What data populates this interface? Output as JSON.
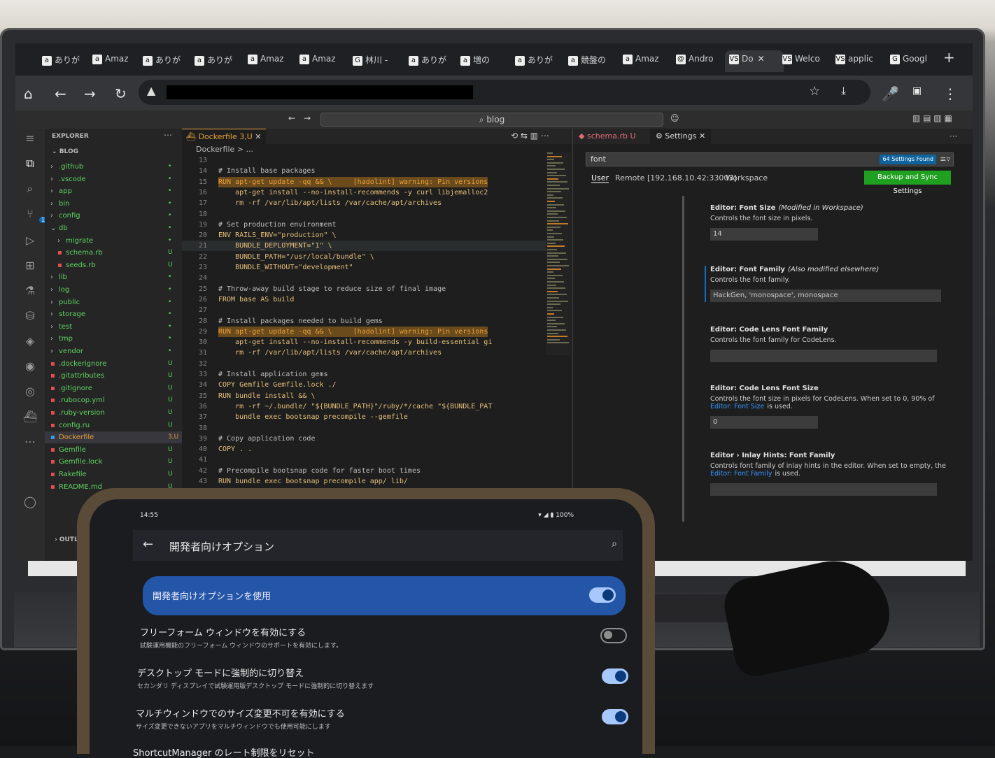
{
  "browser": {
    "tabs": [
      {
        "icon": "a",
        "label": "ありが"
      },
      {
        "icon": "a",
        "label": "Amaz"
      },
      {
        "icon": "a",
        "label": "ありが"
      },
      {
        "icon": "a",
        "label": "ありが"
      },
      {
        "icon": "a",
        "label": "Amaz"
      },
      {
        "icon": "a",
        "label": "Amaz"
      },
      {
        "icon": "G",
        "label": "林川 -"
      },
      {
        "icon": "a",
        "label": "ありが"
      },
      {
        "icon": "a",
        "label": "増の"
      },
      {
        "icon": "a",
        "label": "ありが"
      },
      {
        "icon": "a",
        "label": "競盤の"
      },
      {
        "icon": "a",
        "label": "Amaz"
      },
      {
        "icon": "@",
        "label": "Andro"
      },
      {
        "icon": "VS",
        "label": "Do",
        "active": true
      },
      {
        "icon": "VS",
        "label": "Welco"
      },
      {
        "icon": "VS",
        "label": "applic"
      },
      {
        "icon": "G",
        "label": "Googl"
      }
    ],
    "new_tab": "+",
    "tab_close": "✕"
  },
  "vscode": {
    "command_center": "blog",
    "explorer": {
      "header": "EXPLORER",
      "root": "BLOG",
      "items": [
        {
          "name": ".github",
          "type": "folder",
          "status": "•",
          "color": "#5fd35f"
        },
        {
          "name": ".vscode",
          "type": "folder",
          "status": "•",
          "color": "#5fd35f"
        },
        {
          "name": "app",
          "type": "folder",
          "status": "•",
          "color": "#5fd35f"
        },
        {
          "name": "bin",
          "type": "folder",
          "status": "•",
          "color": "#5fd35f"
        },
        {
          "name": "config",
          "type": "folder",
          "status": "•",
          "color": "#5fd35f"
        },
        {
          "name": "db",
          "type": "folder-open",
          "status": "•",
          "color": "#5fd35f"
        },
        {
          "name": "migrate",
          "type": "folder",
          "status": "•",
          "color": "#5fd35f"
        },
        {
          "name": "schema.rb",
          "type": "file",
          "status": "U",
          "color": "#5fd35f"
        },
        {
          "name": "seeds.rb",
          "type": "file",
          "status": "U",
          "color": "#5fd35f"
        },
        {
          "name": "lib",
          "type": "folder",
          "status": "•",
          "color": "#5fd35f"
        },
        {
          "name": "log",
          "type": "folder",
          "status": "•",
          "color": "#5fd35f"
        },
        {
          "name": "public",
          "type": "folder",
          "status": "•",
          "color": "#5fd35f"
        },
        {
          "name": "storage",
          "type": "folder",
          "status": "•",
          "color": "#5fd35f"
        },
        {
          "name": "test",
          "type": "folder",
          "status": "•",
          "color": "#5fd35f"
        },
        {
          "name": "tmp",
          "type": "folder",
          "status": "•",
          "color": "#5fd35f"
        },
        {
          "name": "vendor",
          "type": "folder",
          "status": "•",
          "color": "#5fd35f"
        },
        {
          "name": ".dockerignore",
          "type": "file",
          "status": "U",
          "color": "#5fd35f"
        },
        {
          "name": ".gitattributes",
          "type": "file",
          "status": "U",
          "color": "#5fd35f"
        },
        {
          "name": ".gitignore",
          "type": "file",
          "status": "U",
          "color": "#5fd35f"
        },
        {
          "name": ".rubocop.yml",
          "type": "file",
          "status": "U",
          "color": "#5fd35f"
        },
        {
          "name": ".ruby-version",
          "type": "file",
          "status": "U",
          "color": "#5fd35f"
        },
        {
          "name": "config.ru",
          "type": "file",
          "status": "U",
          "color": "#5fd35f"
        },
        {
          "name": "Dockerfile",
          "type": "file",
          "status": "3,U",
          "color": "#e8a23c",
          "selected": true
        },
        {
          "name": "Gemfile",
          "type": "file",
          "status": "U",
          "color": "#5fd35f"
        },
        {
          "name": "Gemfile.lock",
          "type": "file",
          "status": "U",
          "color": "#5fd35f"
        },
        {
          "name": "Rakefile",
          "type": "file",
          "status": "U",
          "color": "#5fd35f"
        },
        {
          "name": "README.md",
          "type": "file",
          "status": "U",
          "color": "#5fd35f"
        }
      ],
      "outline": "OUTLINE",
      "activity_badge": "115"
    },
    "editor": {
      "tab_label": "Dockerfile",
      "tab_status": "3,U",
      "breadcrumb": "Dockerfile > ...",
      "lines": [
        {
          "n": "13",
          "t": ""
        },
        {
          "n": "14",
          "t": "# Install base packages",
          "k": "comment"
        },
        {
          "n": "15",
          "t": "RUN apt-get update -qq && \\     [hadolint] warning: Pin versions",
          "k": "warn"
        },
        {
          "n": "16",
          "t": "    apt-get install --no-install-recommends -y curl libjemalloc2",
          "k": "code"
        },
        {
          "n": "17",
          "t": "    rm -rf /var/lib/apt/lists /var/cache/apt/archives",
          "k": "code"
        },
        {
          "n": "18",
          "t": ""
        },
        {
          "n": "19",
          "t": "# Set production environment",
          "k": "comment"
        },
        {
          "n": "20",
          "t": "ENV RAILS_ENV=\"production\" \\",
          "k": "code"
        },
        {
          "n": "21",
          "t": "    BUNDLE_DEPLOYMENT=\"1\" \\",
          "k": "cur"
        },
        {
          "n": "22",
          "t": "    BUNDLE_PATH=\"/usr/local/bundle\" \\",
          "k": "code"
        },
        {
          "n": "23",
          "t": "    BUNDLE_WITHOUT=\"development\"",
          "k": "code"
        },
        {
          "n": "24",
          "t": ""
        },
        {
          "n": "25",
          "t": "# Throw-away build stage to reduce size of final image",
          "k": "comment"
        },
        {
          "n": "26",
          "t": "FROM base AS build",
          "k": "code"
        },
        {
          "n": "27",
          "t": ""
        },
        {
          "n": "28",
          "t": "# Install packages needed to build gems",
          "k": "comment"
        },
        {
          "n": "29",
          "t": "RUN apt-get update -qq && \\     [hadolint] warning: Pin versions",
          "k": "warn"
        },
        {
          "n": "30",
          "t": "    apt-get install --no-install-recommends -y build-essential gi",
          "k": "code"
        },
        {
          "n": "31",
          "t": "    rm -rf /var/lib/apt/lists /var/cache/apt/archives",
          "k": "code"
        },
        {
          "n": "32",
          "t": ""
        },
        {
          "n": "33",
          "t": "# Install application gems",
          "k": "comment"
        },
        {
          "n": "34",
          "t": "COPY Gemfile Gemfile.lock ./",
          "k": "code"
        },
        {
          "n": "35",
          "t": "RUN bundle install && \\",
          "k": "code"
        },
        {
          "n": "36",
          "t": "    rm -rf ~/.bundle/ \"${BUNDLE_PATH}\"/ruby/*/cache \"${BUNDLE_PAT",
          "k": "code"
        },
        {
          "n": "37",
          "t": "    bundle exec bootsnap precompile --gemfile",
          "k": "code"
        },
        {
          "n": "38",
          "t": ""
        },
        {
          "n": "39",
          "t": "# Copy application code",
          "k": "comment"
        },
        {
          "n": "40",
          "t": "COPY . .",
          "k": "code"
        },
        {
          "n": "41",
          "t": ""
        },
        {
          "n": "42",
          "t": "# Precompile bootsnap code for faster boot times",
          "k": "comment"
        },
        {
          "n": "43",
          "t": "RUN bundle exec bootsnap precompile app/ lib/",
          "k": "code"
        }
      ]
    },
    "settings": {
      "tab_schema": "schema.rb U",
      "tab_settings": "Settings",
      "search_value": "font",
      "found_badge": "64 Settings Found",
      "scope_user": "User",
      "scope_remote": "Remote [192.168.10.42:33003]",
      "scope_workspace": "Workspace",
      "sync_button": "Backup and Sync Settings",
      "items": [
        {
          "title": "Editor: Font Size",
          "note": "(Modified in Workspace)",
          "desc": "Controls the font size in pixels.",
          "value": "14"
        },
        {
          "title": "Editor: Font Family",
          "note": "(Also modified elsewhere)",
          "desc": "Controls the font family.",
          "value": "HackGen, 'monospace', monospace"
        },
        {
          "title": "Editor: Code Lens Font Family",
          "note": "",
          "desc": "Controls the font family for CodeLens.",
          "value": ""
        },
        {
          "title": "Editor: Code Lens Font Size",
          "note": "",
          "desc": "Controls the font size in pixels for CodeLens. When set to 0, 90% of",
          "link": "Editor: Font Size",
          "desc2": "is used.",
          "value": "0"
        },
        {
          "title": "Editor › Inlay Hints: Font Family",
          "note": "",
          "desc": "Controls font family of inlay hints in the editor. When set to empty, the",
          "link": "Editor: Font Family",
          "desc2": "is used.",
          "value": ""
        }
      ]
    }
  },
  "phone": {
    "status_left": "14:55",
    "status_right": "100%",
    "title": "開発者向けオプション",
    "main_toggle_label": "開発者向けオプションを使用",
    "main_toggle_on": true,
    "rows": [
      {
        "title": "フリーフォーム ウィンドウを有効にする",
        "desc": "試験運用機能のフリーフォーム ウィンドウのサポートを有効にします。",
        "on": false
      },
      {
        "title": "デスクトップ モードに強制的に切り替え",
        "desc": "セカンダリ ディスプレイで試験運用版デスクトップ モードに強制的に切り替えます",
        "on": true
      },
      {
        "title": "マルチウィンドウでのサイズ変更不可を有効にする",
        "desc": "サイズ変更できないアプリをマルチウィンドウでも使用可能にします",
        "on": true
      },
      {
        "title": "ShortcutManager のレート制限をリセット",
        "desc": "",
        "on": null
      }
    ]
  }
}
